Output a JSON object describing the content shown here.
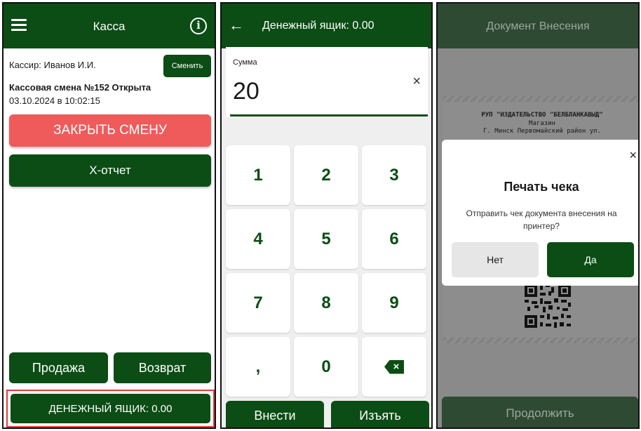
{
  "kassa": {
    "title": "Касса",
    "cashier": "Кассир: Иванов И.И.",
    "change_label": "Сменить",
    "shift": "Кассовая смена №152 Открыта",
    "shift_date": "03.10.2024 в 10:02:15",
    "close_shift_label": "ЗАКРЫТЬ СМЕНУ",
    "x_report_label": "Х-отчет",
    "sale_label": "Продажа",
    "return_label": "Возврат",
    "drawer_label": "ДЕНЕЖНЫЙ ЯЩИК: 0.00",
    "colors": {
      "primary": "#0b4d14",
      "danger": "#ef5b5b",
      "highlight": "#e53935"
    }
  },
  "drawer": {
    "title": "Денежный ящик: 0.00",
    "back_icon": "arrow-left-icon",
    "sum_label": "Сумма",
    "sum_value": "20",
    "clear_symbol": "×",
    "keys": [
      "1",
      "2",
      "3",
      "4",
      "5",
      "6",
      "7",
      "8",
      "9",
      ",",
      "0",
      "⌫"
    ],
    "backspace_symbol": "×",
    "deposit_label": "Внести",
    "withdraw_label": "Изъять"
  },
  "document": {
    "title": "Документ Внесения",
    "receipt_org": "РУП \"ИЗДАТЕЛЬСТВО \"БЕЛБЛАНКАВЫД\"",
    "receipt_shop": "Магазин",
    "receipt_address": "Г. Минск Первомайский район ул.",
    "dialog_title": "Печать чека",
    "dialog_text": "Отправить чек документа внесения на принтер?",
    "dialog_close": "×",
    "no_label": "Нет",
    "yes_label": "Да",
    "continue_label": "Продолжить"
  }
}
